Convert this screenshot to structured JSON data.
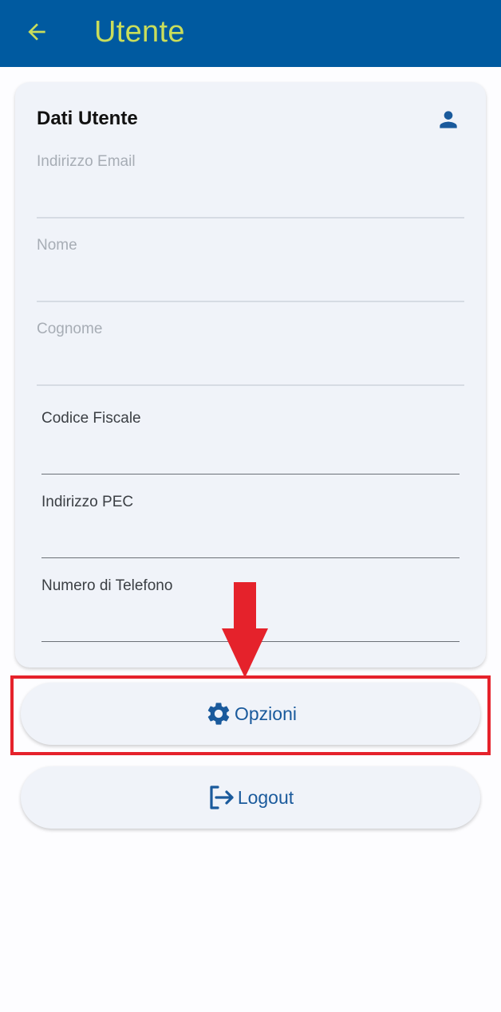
{
  "appbar": {
    "title": "Utente",
    "background": "#005aa0",
    "title_color": "#c9dd5b",
    "back_icon": "arrow-left-icon"
  },
  "card": {
    "title": "Dati Utente",
    "icon": "person-icon",
    "fields": [
      {
        "label": "Indirizzo Email",
        "value": ""
      },
      {
        "label": "Nome",
        "value": ""
      },
      {
        "label": "Cognome",
        "value": ""
      },
      {
        "label": "Codice Fiscale",
        "value": ""
      },
      {
        "label": "Indirizzo PEC",
        "value": ""
      },
      {
        "label": "Numero di Telefono",
        "value": ""
      }
    ]
  },
  "buttons": {
    "options_label": "Opzioni",
    "options_icon": "gear-icon",
    "logout_label": "Logout",
    "logout_icon": "logout-icon"
  },
  "annotation": {
    "highlight_color": "#e5222b",
    "arrow_icon": "arrow-down-icon"
  }
}
